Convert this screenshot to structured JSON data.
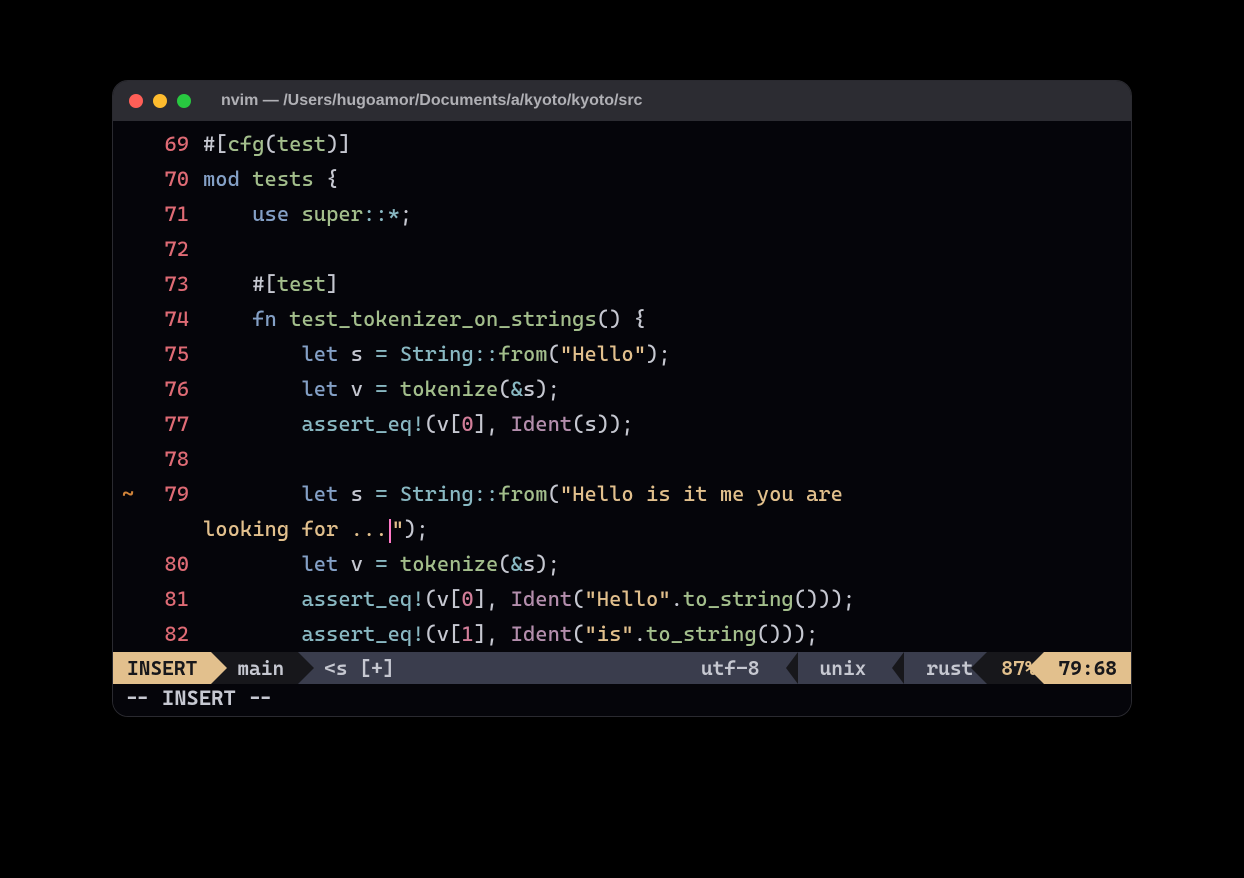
{
  "window": {
    "title": "nvim — /Users/hugoamor/Documents/a/kyoto/kyoto/src"
  },
  "lines": [
    {
      "n": "69",
      "sign": "",
      "tokens": [
        [
          "pu",
          "#["
        ],
        [
          "fn",
          "cfg"
        ],
        [
          "pu",
          "("
        ],
        [
          "fn",
          "test"
        ],
        [
          "pu",
          ")]"
        ]
      ]
    },
    {
      "n": "70",
      "sign": "",
      "tokens": [
        [
          "kw",
          "mod"
        ],
        [
          "pu",
          " "
        ],
        [
          "fn",
          "tests"
        ],
        [
          "pu",
          " {"
        ]
      ]
    },
    {
      "n": "71",
      "sign": "",
      "tokens": [
        [
          "pu",
          "    "
        ],
        [
          "kw",
          "use"
        ],
        [
          "pu",
          " "
        ],
        [
          "fn",
          "super"
        ],
        [
          "op",
          "::"
        ],
        [
          "op",
          "*"
        ],
        [
          "pu",
          ";"
        ]
      ]
    },
    {
      "n": "72",
      "sign": "",
      "tokens": [
        [
          "pu",
          ""
        ]
      ]
    },
    {
      "n": "73",
      "sign": "",
      "tokens": [
        [
          "pu",
          "    "
        ],
        [
          "pu",
          "#["
        ],
        [
          "fn",
          "test"
        ],
        [
          "pu",
          "]"
        ]
      ]
    },
    {
      "n": "74",
      "sign": "",
      "tokens": [
        [
          "pu",
          "    "
        ],
        [
          "kw",
          "fn"
        ],
        [
          "pu",
          " "
        ],
        [
          "fn",
          "test_tokenizer_on_strings"
        ],
        [
          "pu",
          "() {"
        ]
      ]
    },
    {
      "n": "75",
      "sign": "",
      "tokens": [
        [
          "pu",
          "        "
        ],
        [
          "kw",
          "let"
        ],
        [
          "pu",
          " "
        ],
        [
          "mut",
          "s"
        ],
        [
          "pu",
          " "
        ],
        [
          "op",
          "="
        ],
        [
          "pu",
          " "
        ],
        [
          "ty",
          "String"
        ],
        [
          "op",
          "::"
        ],
        [
          "fn",
          "from"
        ],
        [
          "pu",
          "("
        ],
        [
          "str",
          "\"Hello\""
        ],
        [
          "pu",
          ");"
        ]
      ]
    },
    {
      "n": "76",
      "sign": "",
      "tokens": [
        [
          "pu",
          "        "
        ],
        [
          "kw",
          "let"
        ],
        [
          "pu",
          " "
        ],
        [
          "mut",
          "v"
        ],
        [
          "pu",
          " "
        ],
        [
          "op",
          "="
        ],
        [
          "pu",
          " "
        ],
        [
          "fn",
          "tokenize"
        ],
        [
          "pu",
          "("
        ],
        [
          "op",
          "&"
        ],
        [
          "mut",
          "s"
        ],
        [
          "pu",
          ");"
        ]
      ]
    },
    {
      "n": "77",
      "sign": "",
      "tokens": [
        [
          "pu",
          "        "
        ],
        [
          "mac",
          "assert_eq!"
        ],
        [
          "pu",
          "("
        ],
        [
          "mut",
          "v"
        ],
        [
          "pu",
          "["
        ],
        [
          "num",
          "0"
        ],
        [
          "pu",
          "], "
        ],
        [
          "vi",
          "Ident"
        ],
        [
          "pu",
          "("
        ],
        [
          "mut",
          "s"
        ],
        [
          "pu",
          "));"
        ]
      ]
    },
    {
      "n": "78",
      "sign": "",
      "tokens": [
        [
          "pu",
          ""
        ]
      ]
    },
    {
      "n": "79",
      "sign": "~",
      "tokens": [
        [
          "pu",
          "        "
        ],
        [
          "kw",
          "let"
        ],
        [
          "pu",
          " "
        ],
        [
          "mut",
          "s"
        ],
        [
          "pu",
          " "
        ],
        [
          "op",
          "="
        ],
        [
          "pu",
          " "
        ],
        [
          "ty",
          "String"
        ],
        [
          "op",
          "::"
        ],
        [
          "fn",
          "from"
        ],
        [
          "pu",
          "("
        ],
        [
          "str",
          "\"Hello is it me you are "
        ]
      ]
    },
    {
      "n": "",
      "sign": "",
      "wrap": true,
      "tokens": [
        [
          "str",
          "looking for ..."
        ],
        [
          "cursor",
          ""
        ],
        [
          "str",
          "\""
        ],
        [
          "pu",
          ");"
        ]
      ]
    },
    {
      "n": "80",
      "sign": "",
      "tokens": [
        [
          "pu",
          "        "
        ],
        [
          "kw",
          "let"
        ],
        [
          "pu",
          " "
        ],
        [
          "mut",
          "v"
        ],
        [
          "pu",
          " "
        ],
        [
          "op",
          "="
        ],
        [
          "pu",
          " "
        ],
        [
          "fn",
          "tokenize"
        ],
        [
          "pu",
          "("
        ],
        [
          "op",
          "&"
        ],
        [
          "mut",
          "s"
        ],
        [
          "pu",
          ");"
        ]
      ]
    },
    {
      "n": "81",
      "sign": "",
      "tokens": [
        [
          "pu",
          "        "
        ],
        [
          "mac",
          "assert_eq!"
        ],
        [
          "pu",
          "("
        ],
        [
          "mut",
          "v"
        ],
        [
          "pu",
          "["
        ],
        [
          "num",
          "0"
        ],
        [
          "pu",
          "], "
        ],
        [
          "vi",
          "Ident"
        ],
        [
          "pu",
          "("
        ],
        [
          "str",
          "\"Hello\""
        ],
        [
          "pu",
          "."
        ],
        [
          "fn",
          "to_string"
        ],
        [
          "pu",
          "()));"
        ]
      ]
    },
    {
      "n": "82",
      "sign": "",
      "tokens": [
        [
          "pu",
          "        "
        ],
        [
          "mac",
          "assert_eq!"
        ],
        [
          "pu",
          "("
        ],
        [
          "mut",
          "v"
        ],
        [
          "pu",
          "["
        ],
        [
          "num",
          "1"
        ],
        [
          "pu",
          "], "
        ],
        [
          "vi",
          "Ident"
        ],
        [
          "pu",
          "("
        ],
        [
          "str",
          "\"is\""
        ],
        [
          "pu",
          "."
        ],
        [
          "fn",
          "to_string"
        ],
        [
          "pu",
          "()));"
        ]
      ]
    }
  ],
  "status": {
    "mode": "INSERT",
    "branch": "main",
    "file_short": "<s [+]",
    "encoding": "utf-8",
    "fileformat": "unix",
    "filetype": "rust",
    "percent": "87%",
    "position": "79:68"
  },
  "cmdline": "-- INSERT --"
}
